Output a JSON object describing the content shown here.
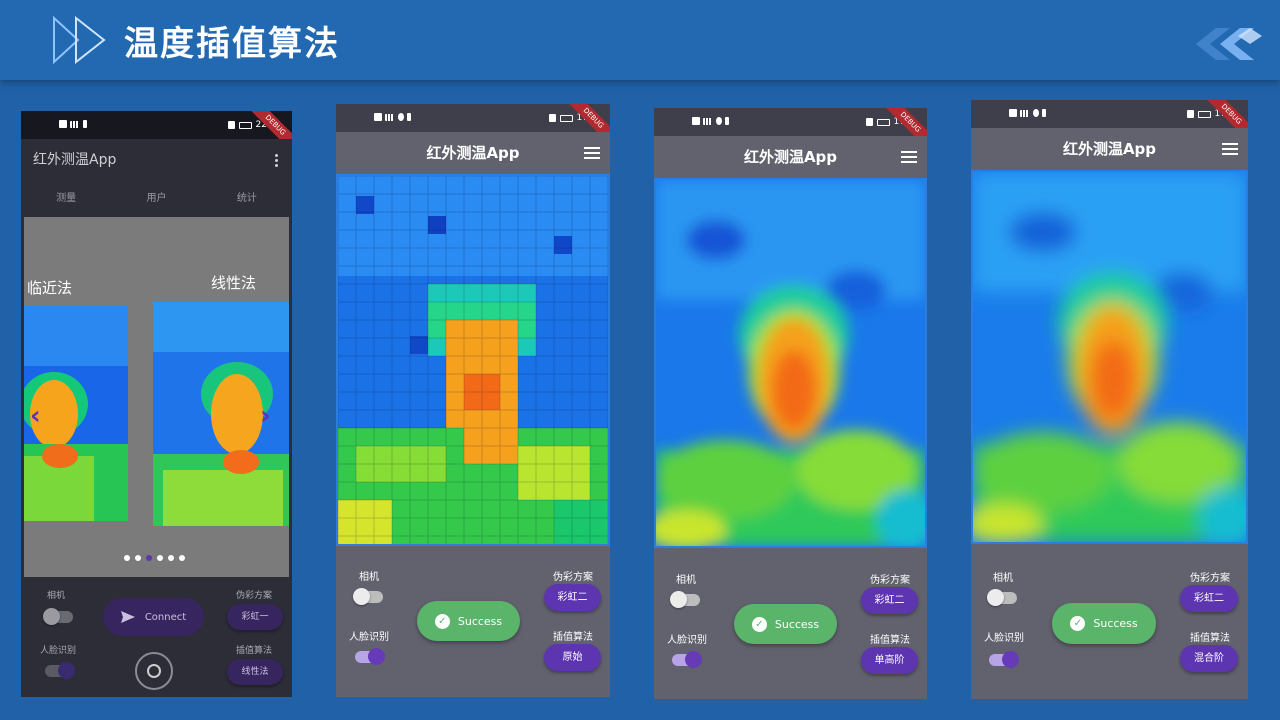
{
  "slide": {
    "title": "温度插值算法"
  },
  "phone1": {
    "status_time": "22:",
    "debug": "DEBUG",
    "app_title": "红外测温App",
    "tabs": [
      "测量",
      "用户",
      "统计"
    ],
    "left_label": "临近法",
    "right_label": "线性法",
    "carousel_pages": 6,
    "carousel_active": 2,
    "camera_label": "相机",
    "face_label": "人脸识别",
    "camera_toggle": false,
    "face_toggle": true,
    "connect_label": "Connect",
    "palette_label": "伪彩方案",
    "palette_value": "彩虹一",
    "interp_label": "插值算法",
    "interp_value": "线性法"
  },
  "phones": [
    {
      "status_time": "17",
      "debug": "DEBUG",
      "app_title": "红外测温App",
      "camera_label": "相机",
      "face_label": "人脸识别",
      "camera_toggle": false,
      "face_toggle": true,
      "success_label": "Success",
      "palette_label": "伪彩方案",
      "palette_value": "彩虹二",
      "interp_label": "插值算法",
      "interp_value": "原始"
    },
    {
      "status_time": "17",
      "debug": "DEBUG",
      "app_title": "红外测温App",
      "camera_label": "相机",
      "face_label": "人脸识别",
      "camera_toggle": false,
      "face_toggle": true,
      "success_label": "Success",
      "palette_label": "伪彩方案",
      "palette_value": "彩虹二",
      "interp_label": "插值算法",
      "interp_value": "单高阶"
    },
    {
      "status_time": "17",
      "debug": "DEBUG",
      "app_title": "红外测温App",
      "camera_label": "相机",
      "face_label": "人脸识别",
      "camera_toggle": false,
      "face_toggle": true,
      "success_label": "Success",
      "palette_label": "伪彩方案",
      "palette_value": "彩虹二",
      "interp_label": "插值算法",
      "interp_value": "混合阶"
    }
  ],
  "colors": {
    "background": "#2061a8",
    "accent": "#5e35b1",
    "success": "#5ab56a",
    "debug_ribbon": "#b22a2f"
  },
  "icons": [
    "play-double-arrow-icon",
    "brand-logo-icon",
    "menu-icon",
    "send-icon",
    "camera-shutter-icon",
    "check-circle-icon"
  ]
}
